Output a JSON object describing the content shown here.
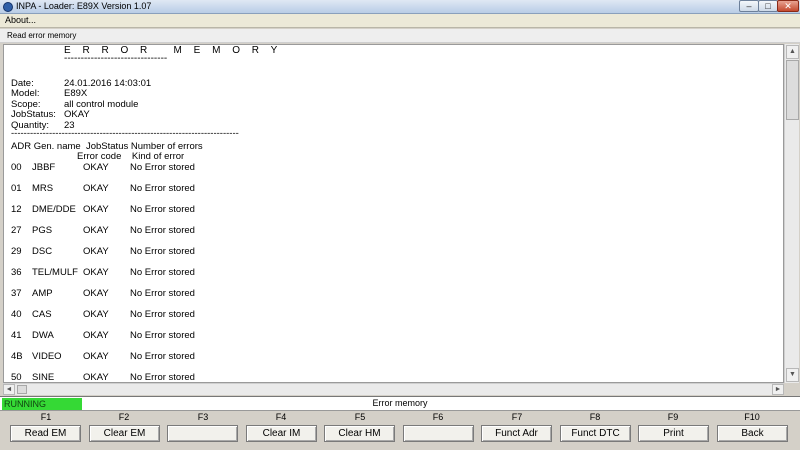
{
  "window": {
    "title": "INPA - Loader:  E89X Version 1.07",
    "min_symbol": "–",
    "max_symbol": "□",
    "close_symbol": "✕"
  },
  "menu": {
    "about": "About..."
  },
  "panel": {
    "title": "Read error memory"
  },
  "report": {
    "heading": "E R R O R   M E M O R Y",
    "underline": "-------------------------------",
    "info": [
      {
        "label": "Date:",
        "value": "24.01.2016 14:03:01"
      },
      {
        "label": "Model:",
        "value": "E89X"
      },
      {
        "label": "Scope:",
        "value": "all control module"
      },
      {
        "label": "JobStatus:",
        "value": "OKAY"
      },
      {
        "label": "Quantity:",
        "value": "23"
      }
    ],
    "separator": "------------------------------------------------------------------------",
    "header1": "ADR Gen. name  JobStatus Number of errors",
    "header2": "Error code    Kind of error",
    "rows": [
      {
        "adr": "00",
        "name": "JBBF",
        "status": "OKAY",
        "errors": "No Error stored"
      },
      {
        "adr": "01",
        "name": "MRS",
        "status": "OKAY",
        "errors": "No Error stored"
      },
      {
        "adr": "12",
        "name": "DME/DDE",
        "status": "OKAY",
        "errors": "No Error stored"
      },
      {
        "adr": "27",
        "name": "PGS",
        "status": "OKAY",
        "errors": "No Error stored"
      },
      {
        "adr": "29",
        "name": "DSC",
        "status": "OKAY",
        "errors": "No Error stored"
      },
      {
        "adr": "36",
        "name": "TEL/MULF",
        "status": "OKAY",
        "errors": "No Error stored"
      },
      {
        "adr": "37",
        "name": "AMP",
        "status": "OKAY",
        "errors": "No Error stored"
      },
      {
        "adr": "40",
        "name": "CAS",
        "status": "OKAY",
        "errors": "No Error stored"
      },
      {
        "adr": "41",
        "name": "DWA",
        "status": "OKAY",
        "errors": "No Error stored"
      },
      {
        "adr": "4B",
        "name": "VIDEO",
        "status": "OKAY",
        "errors": "No Error stored"
      },
      {
        "adr": "50",
        "name": "SINE",
        "status": "OKAY",
        "errors": "No Error stored"
      }
    ]
  },
  "scroll": {
    "up": "▲",
    "down": "▼",
    "left": "◄",
    "right": "►"
  },
  "status": {
    "running": "RUNNING",
    "title": "Error memory"
  },
  "fkeys": [
    {
      "key": "F1",
      "label": "Read EM"
    },
    {
      "key": "F2",
      "label": "Clear EM"
    },
    {
      "key": "F3",
      "label": ""
    },
    {
      "key": "F4",
      "label": "Clear IM"
    },
    {
      "key": "F5",
      "label": "Clear HM"
    },
    {
      "key": "F6",
      "label": ""
    },
    {
      "key": "F7",
      "label": "Funct Adr"
    },
    {
      "key": "F8",
      "label": "Funct DTC"
    },
    {
      "key": "F9",
      "label": "Print"
    },
    {
      "key": "F10",
      "label": "Back"
    }
  ]
}
